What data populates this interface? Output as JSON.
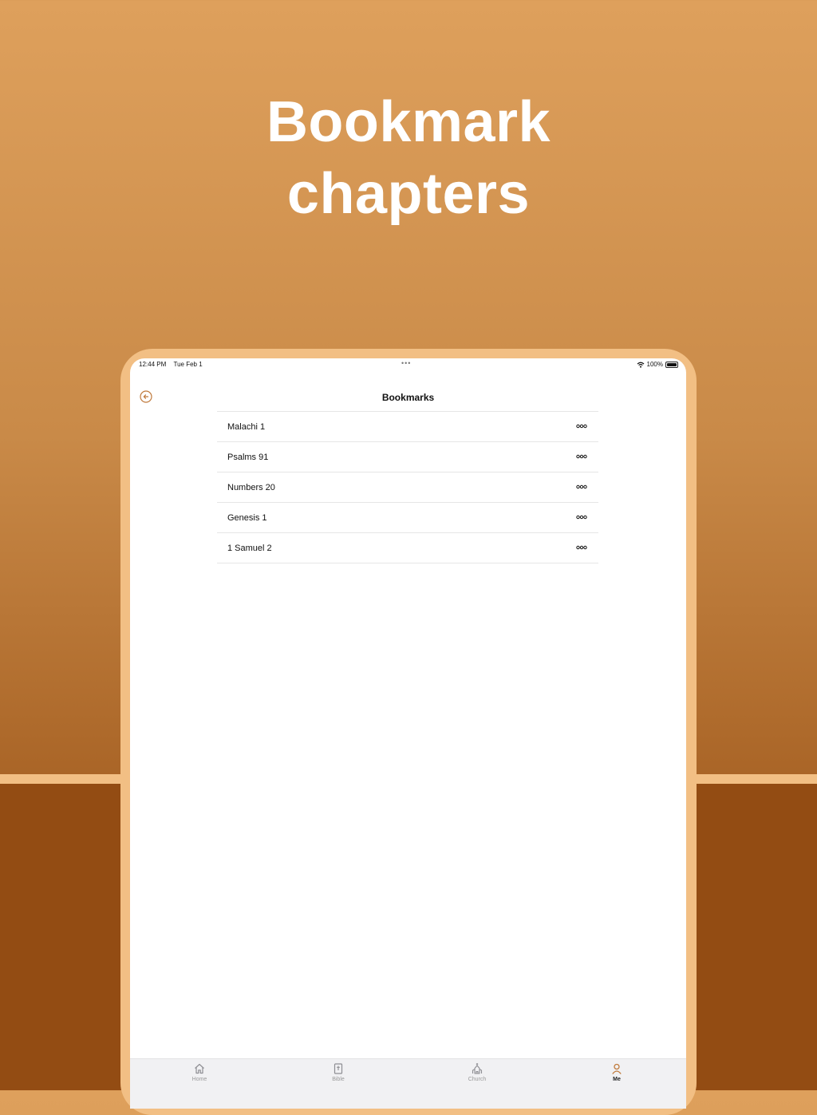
{
  "headline": {
    "line1": "Bookmark",
    "line2": "chapters"
  },
  "colors": {
    "accent": "#c07a3c",
    "frame": "#f2bf84",
    "background_top": "#dea05c",
    "background_bottom": "#934c13"
  },
  "status_bar": {
    "time": "12:44 PM",
    "date": "Tue Feb 1",
    "battery": "100%"
  },
  "nav": {
    "title": "Bookmarks",
    "back_icon": "back-arrow-circle-icon"
  },
  "bookmarks": [
    {
      "label": "Malachi 1",
      "icon": "more-icon"
    },
    {
      "label": "Psalms 91",
      "icon": "more-icon"
    },
    {
      "label": "Numbers 20",
      "icon": "more-icon"
    },
    {
      "label": "Genesis 1",
      "icon": "more-icon"
    },
    {
      "label": "1 Samuel 2",
      "icon": "more-icon"
    }
  ],
  "tabs": [
    {
      "label": "Home",
      "icon": "home-icon",
      "active": false
    },
    {
      "label": "Bible",
      "icon": "bible-icon",
      "active": false
    },
    {
      "label": "Church",
      "icon": "church-icon",
      "active": false
    },
    {
      "label": "Me",
      "icon": "person-icon",
      "active": true
    }
  ]
}
